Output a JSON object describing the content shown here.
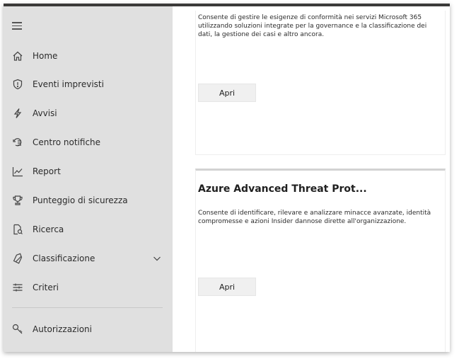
{
  "sidebar": {
    "items": [
      {
        "label": "Home",
        "icon": "home-icon"
      },
      {
        "label": "Eventi imprevisti",
        "icon": "shield-icon"
      },
      {
        "label": "Avvisi",
        "icon": "lightning-icon"
      },
      {
        "label": "Centro notifiche",
        "icon": "notification-center-icon"
      },
      {
        "label": "Report",
        "icon": "chart-icon"
      },
      {
        "label": "Punteggio di sicurezza",
        "icon": "trophy-icon"
      },
      {
        "label": "Ricerca",
        "icon": "search-icon"
      },
      {
        "label": "Classificazione",
        "icon": "tag-icon"
      },
      {
        "label": "Criteri",
        "icon": "sliders-icon"
      },
      {
        "label": "Autorizzazioni",
        "icon": "key-icon"
      }
    ]
  },
  "cards": [
    {
      "title": "",
      "description": "Consente di gestire le esigenze di conformità nei servizi Microsoft 365 utilizzando soluzioni integrate per la governance e la classificazione dei dati, la gestione dei casi e altro ancora.",
      "button_label": "Apri"
    },
    {
      "title": "Azure Advanced Threat Prot...",
      "description": "Consente di identificare, rilevare e analizzare minacce avanzate, identità compromesse e azioni Insider dannose dirette all'organizzazione.",
      "button_label": "Apri"
    }
  ],
  "colors": {
    "sidebar_bg": "#e0e0e0",
    "top_bar": "#3b3a39",
    "button_bg": "#f0f0f0"
  }
}
